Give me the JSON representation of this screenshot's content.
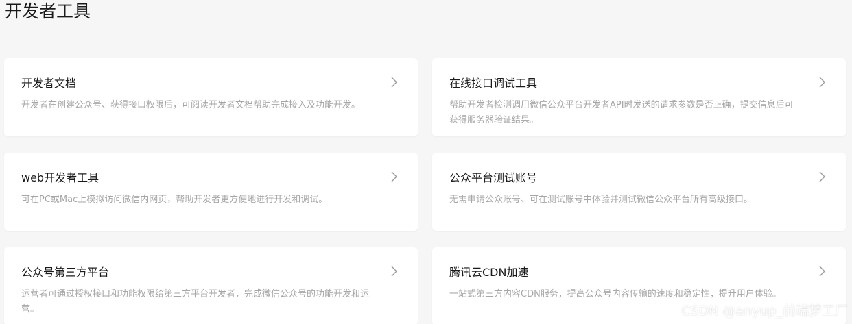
{
  "page": {
    "title": "开发者工具"
  },
  "cards": [
    {
      "title": "开发者文档",
      "desc": "开发者在创建公众号、获得接口权限后，可阅读开发者文档帮助完成接入及功能开发。"
    },
    {
      "title": "在线接口调试工具",
      "desc": "帮助开发者检测调用微信公众平台开发者API时发送的请求参数是否正确，提交信息后可获得服务器验证结果。"
    },
    {
      "title": "web开发者工具",
      "desc": "可在PC或Mac上模拟访问微信内网页，帮助开发者更方便地进行开发和调试。"
    },
    {
      "title": "公众平台测试账号",
      "desc": "无需申请公众账号、可在测试账号中体验并测试微信公众平台所有高级接口。"
    },
    {
      "title": "公众号第三方平台",
      "desc": "运营者可通过授权接口和功能权限给第三方平台开发者，完成微信公众号的功能开发和运营。"
    },
    {
      "title": "腾讯云CDN加速",
      "desc": "一站式第三方内容CDN服务，提高公众号内容传输的速度和稳定性，提升用户体验。"
    }
  ],
  "watermark": "CSDN @anyup_前端梦工厂",
  "icons": {
    "card_arrow": "chevron-right-icon"
  },
  "colors": {
    "background": "#f6f6f6",
    "card": "#ffffff",
    "title": "#1a1a1a",
    "desc": "#a6a6a6",
    "chevron": "#9a9a9a"
  }
}
